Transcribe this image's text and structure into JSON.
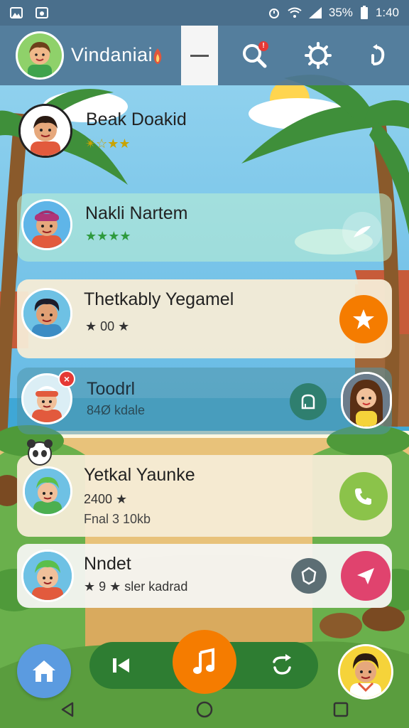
{
  "status_bar": {
    "battery": "35%",
    "time": "1:40"
  },
  "header": {
    "title": "Vindaniai",
    "notification_badge": "!"
  },
  "contacts": [
    {
      "name": "Beak Doakid",
      "sub": "✴☆★★"
    },
    {
      "name": "Nakli Nartem",
      "sub": "★★★★"
    },
    {
      "name": "Thetkably Yegamel",
      "sub": "★ 00 ★"
    },
    {
      "name": "Toodrl",
      "sub": "84Ø kdale"
    },
    {
      "name": "Yetkal Yaunke",
      "sub": "2400 ★",
      "sub2": "Fnal 3 10kb"
    },
    {
      "name": "Nndet",
      "sub": "★ 9 ★ sler kadrad"
    }
  ],
  "colors": {
    "header": "#4e7696",
    "orange": "#f57c00",
    "green_player": "#2e7d32",
    "call_green": "#8bc34a",
    "pink": "#e0436e",
    "home_blue": "#5b9be0"
  },
  "icons": [
    "search-icon",
    "settings-icon",
    "refresh-icon",
    "send-icon",
    "star-icon",
    "pot-icon",
    "phone-icon",
    "shield-icon",
    "home-icon",
    "skip-back-icon",
    "music-note-icon",
    "repeat-icon",
    "back-nav-icon",
    "home-nav-icon",
    "recents-nav-icon"
  ]
}
